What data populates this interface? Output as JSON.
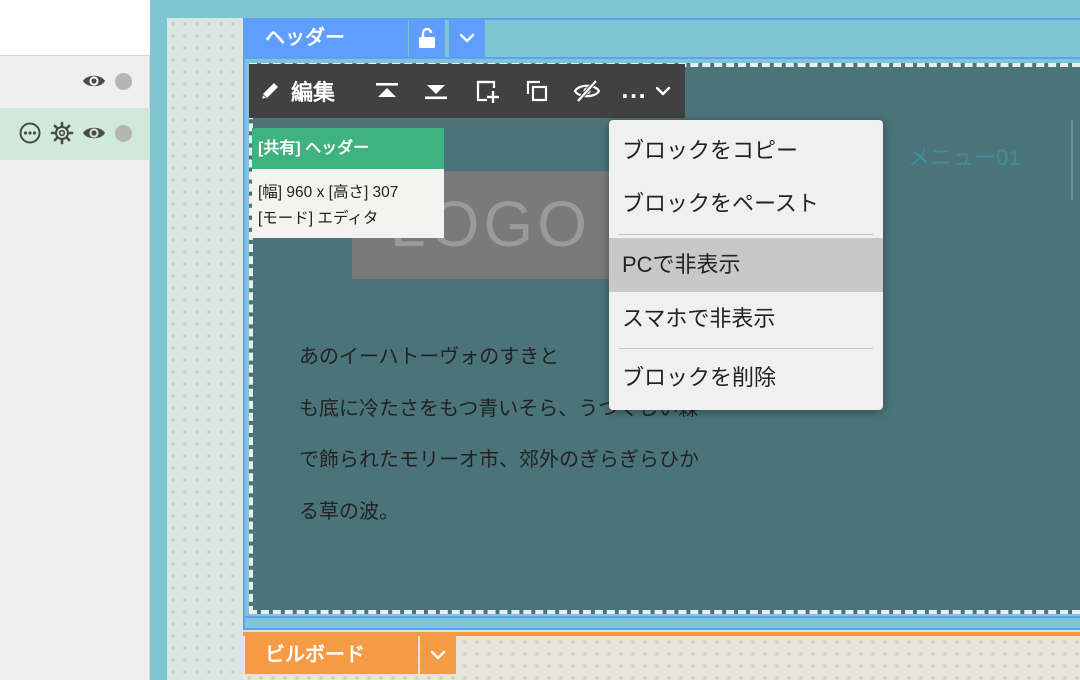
{
  "layers_panel": {
    "rows": [
      {
        "icons": [
          "eye-icon",
          "status-dot"
        ]
      },
      {
        "icons": [
          "more-circle-icon",
          "gear-icon",
          "eye-icon",
          "status-dot"
        ],
        "selected": true
      }
    ]
  },
  "header_section": {
    "tab_label": "ヘッダー",
    "lock_icon": "lock-open-icon",
    "chevron_icon": "chevron-down-icon"
  },
  "toolbar": {
    "edit_label": "編集",
    "more_label": "...",
    "icons": [
      "pencil-icon",
      "move-top-icon",
      "move-bottom-icon",
      "add-block-icon",
      "duplicate-icon",
      "hide-icon",
      "chevron-down-icon"
    ]
  },
  "block_info": {
    "title": "[共有] ヘッダー",
    "size": "[幅] 960 x [高さ] 307",
    "mode": "[モード] エディタ"
  },
  "logo": {
    "text": "LOGO"
  },
  "nav": {
    "menu_item": "メニュー01"
  },
  "paragraph": {
    "lines": [
      "あのイーハトーヴォのすきと",
      "も底に冷たさをもつ青いそら、うつくしい森",
      "で飾られたモリーオ市、郊外のぎらぎらひか",
      "る草の波。"
    ]
  },
  "dropdown": {
    "items": [
      "ブロックをコピー",
      "ブロックをペースト",
      "PCで非表示",
      "スマホで非表示",
      "ブロックを削除"
    ],
    "highlighted": "PCで非表示"
  },
  "billboard_section": {
    "tab_label": "ビルボード"
  },
  "colors": {
    "header_tab": "#5f9dff",
    "billboard_tab": "#f59a45",
    "block_bg": "#4b747a",
    "info_green": "#3fb27f"
  }
}
